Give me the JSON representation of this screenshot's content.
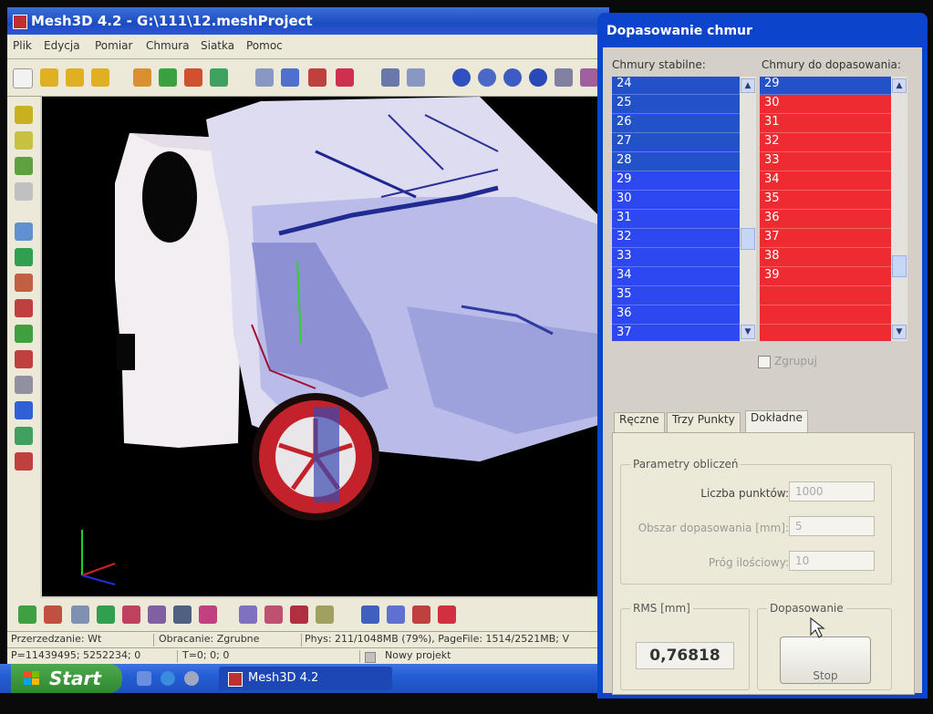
{
  "main_window": {
    "title": "Mesh3D 4.2 - G:\\111\\12.meshProject",
    "menu": [
      "Plik",
      "Edycja",
      "Pomiar",
      "Chmura",
      "Siatka",
      "Pomoc"
    ],
    "status_line1": {
      "left": "Przerzedzanie: Wt",
      "middle": "Obracanie: Zgrubne",
      "right": "Phys: 211/1048MB (79%), PageFile: 1514/2521MB; V"
    },
    "status_line2": {
      "left": "P=11439495; 5252234; 0",
      "middle": "T=0; 0; 0",
      "right": "Nowy projekt"
    }
  },
  "taskbar": {
    "start_label": "Start",
    "task_label": "Mesh3D 4.2"
  },
  "dialog": {
    "title": "Dopasowanie chmur",
    "stable_label": "Chmury stabilne:",
    "fit_label": "Chmury do dopasowania:",
    "stable_items": [
      "24",
      "25",
      "26",
      "27",
      "28",
      "29",
      "30",
      "31",
      "32",
      "33",
      "34",
      "35",
      "36",
      "37"
    ],
    "stable_selected_count": 5,
    "fit_items": [
      "29",
      "30",
      "31",
      "32",
      "33",
      "34",
      "35",
      "36",
      "37",
      "38",
      "39",
      "",
      "",
      ""
    ],
    "group_checkbox_label": "Zgrupuj",
    "tabs": [
      "Ręczne",
      "Trzy Punkty",
      "Dokładne"
    ],
    "active_tab": "Dokładne",
    "params_group_title": "Parametry obliczeń",
    "params": [
      {
        "label": "Liczba punktów:",
        "value": "1000"
      },
      {
        "label": "Obszar dopasowania [mm]:",
        "value": "5"
      },
      {
        "label": "Próg ilościowy:",
        "value": "10"
      }
    ],
    "rms_group_title": "RMS [mm]",
    "rms_value": "0,76818",
    "fit_group_title": "Dopasowanie",
    "stop_label": "Stop"
  },
  "colors": {
    "stable_selected": "#2352c8",
    "stable_normal": "#2d48f0",
    "fit_row": "#ee2b30",
    "fit_selected": "#2352c8",
    "title_bar": "#1a4cc0"
  }
}
